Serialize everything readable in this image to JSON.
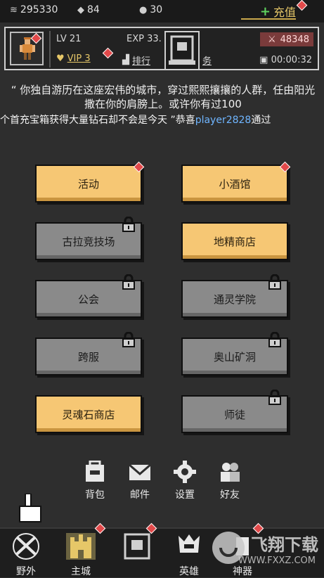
{
  "resources": {
    "coins": "295330",
    "diamonds": "84",
    "tokens": "30",
    "charge_label": "充值"
  },
  "player": {
    "level": "LV 21",
    "exp": "EXP 33.",
    "vip": "VIP 3",
    "rank_label": "排行",
    "task_label": "务",
    "power": "48348",
    "timer": "00:00:32"
  },
  "story": {
    "text": "“ 你独自游历在这座宏伟的城市，穿过熙熙攘攘的人群，任由阳光撒在你的肩膀上。或许你有过100",
    "ticker_prefix": "个首充宝箱获得大量钻石",
    "ticker_middle": "却不会是今天 ”恭喜",
    "ticker_player": "player2828",
    "ticker_suffix": "通过"
  },
  "menu": [
    {
      "label": "活动",
      "locked": false
    },
    {
      "label": "小酒馆",
      "locked": false
    },
    {
      "label": "古拉竞技场",
      "locked": true
    },
    {
      "label": "地精商店",
      "locked": false
    },
    {
      "label": "公会",
      "locked": true
    },
    {
      "label": "通灵学院",
      "locked": true
    },
    {
      "label": "跨服",
      "locked": true
    },
    {
      "label": "奥山矿洞",
      "locked": true
    },
    {
      "label": "灵魂石商店",
      "locked": false
    },
    {
      "label": "师徒",
      "locked": true
    }
  ],
  "quick": {
    "bag": "背包",
    "mail": "邮件",
    "settings": "设置",
    "friends": "好友"
  },
  "nav": {
    "wild": "野外",
    "city": "主城",
    "hero": "英雄",
    "equip": "神器"
  },
  "watermark": {
    "logo": "飞翔下载",
    "url": "WWW.FXXZ.COM"
  },
  "colors": {
    "active_button": "#f6c774",
    "locked_button": "#8a8a8a",
    "notice_dot": "#e2494a",
    "highlight_player": "#6fb5ff"
  }
}
